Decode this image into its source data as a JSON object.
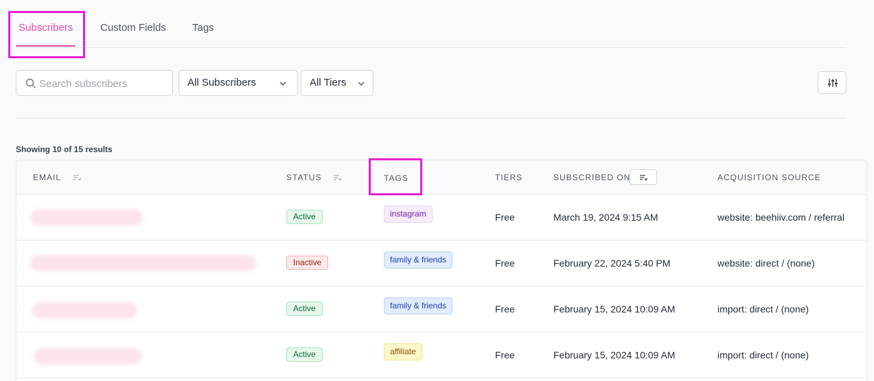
{
  "tabs": [
    {
      "label": "Subscribers",
      "active": true
    },
    {
      "label": "Custom Fields",
      "active": false
    },
    {
      "label": "Tags",
      "active": false
    }
  ],
  "search": {
    "placeholder": "Search subscribers",
    "value": ""
  },
  "filters": {
    "audience": "All Subscribers",
    "tiers": "All Tiers"
  },
  "results_text": "Showing 10 of 15 results",
  "table": {
    "columns": [
      "EMAIL",
      "STATUS",
      "TAGS",
      "TIERS",
      "SUBSCRIBED ON",
      "ACQUISITION SOURCE"
    ],
    "rows": [
      {
        "email": "",
        "status": "Active",
        "tag": "instagram",
        "tier": "Free",
        "subscribed_on": "March 19, 2024 9:15 AM",
        "source": "website: beehiiv.com / referral"
      },
      {
        "email": "",
        "status": "Inactive",
        "tag": "family & friends",
        "tier": "Free",
        "subscribed_on": "February 22, 2024 5:40 PM",
        "source": "website: direct / (none)"
      },
      {
        "email": "",
        "status": "Active",
        "tag": "family & friends",
        "tier": "Free",
        "subscribed_on": "February 15, 2024 10:09 AM",
        "source": "import: direct / (none)"
      },
      {
        "email": "",
        "status": "Active",
        "tag": "affiliate",
        "tier": "Free",
        "subscribed_on": "February 15, 2024 10:09 AM",
        "source": "import: direct / (none)"
      }
    ]
  },
  "colors": {
    "accent": "#e44ba6",
    "highlight_box": "#e81fd4"
  },
  "icons": [
    "search-icon",
    "chevron-down-icon",
    "sliders-icon",
    "sort-icon"
  ]
}
